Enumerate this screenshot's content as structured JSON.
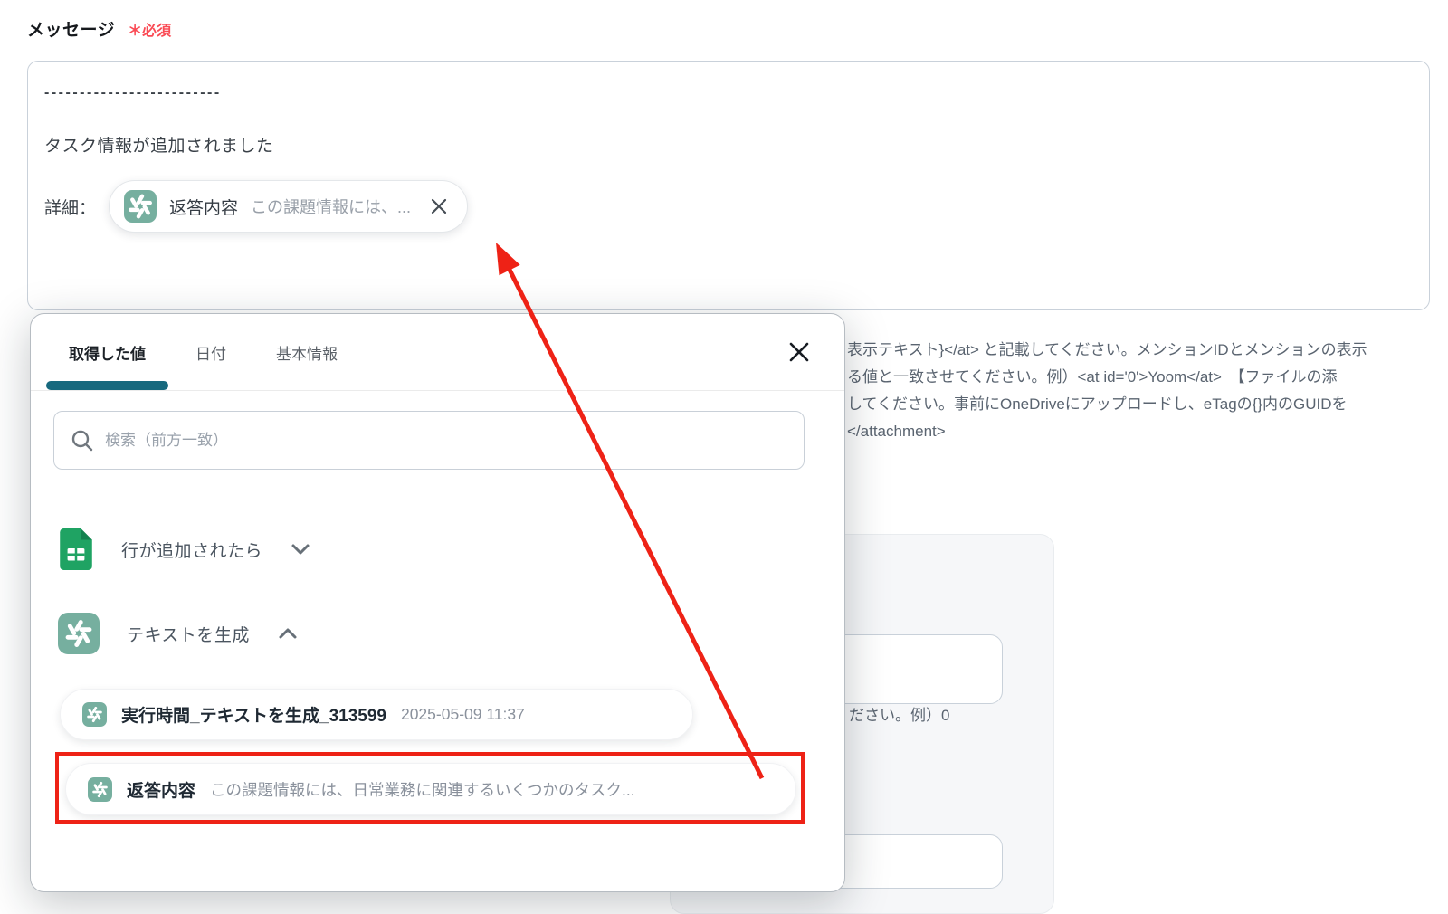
{
  "page": {
    "field_label": "メッセージ",
    "required_label": "＊必須"
  },
  "textarea": {
    "line1": "-------------------------",
    "line2": "タスク情報が追加されました",
    "detail_prefix": "詳細：",
    "chip": {
      "icon": "openai-icon",
      "title": "返答内容",
      "preview": "この課題情報には、..."
    }
  },
  "background_text": {
    "line1": "表示テキスト}</at> と記載してください。メンションIDとメンションの表示",
    "line2": "る値と一致させてください。例）<at id='0'>Yoom</at>　【ファイルの添",
    "line3": "してください。事前にOneDriveにアップロードし、eTagの{}内のGUIDを",
    "line4": "</attachment>",
    "panel_hint": "ださい。例）0"
  },
  "modal": {
    "tabs": [
      {
        "label": "取得した値",
        "active": true
      },
      {
        "label": "日付",
        "active": false
      },
      {
        "label": "基本情報",
        "active": false
      }
    ],
    "search_placeholder": "検索（前方一致）",
    "groups": [
      {
        "icon": "google-sheets-icon",
        "label": "行が追加されたら",
        "state": "collapsed"
      },
      {
        "icon": "openai-icon",
        "label": "テキストを生成",
        "state": "expanded"
      }
    ],
    "items": [
      {
        "icon": "openai-icon",
        "title": "実行時間_テキストを生成_313599",
        "meta": "2025-05-09 11:37",
        "highlighted": false
      },
      {
        "icon": "openai-icon",
        "title": "返答内容",
        "meta": "この課題情報には、日常業務に関連するいくつかのタスク...",
        "highlighted": true
      }
    ]
  },
  "colors": {
    "tab_accent": "#17697E",
    "openai_icon_bg": "#76AF9F",
    "sheets_green": "#1FA363",
    "annotation_red": "#EE2216",
    "required_red": "#FA4B55"
  }
}
